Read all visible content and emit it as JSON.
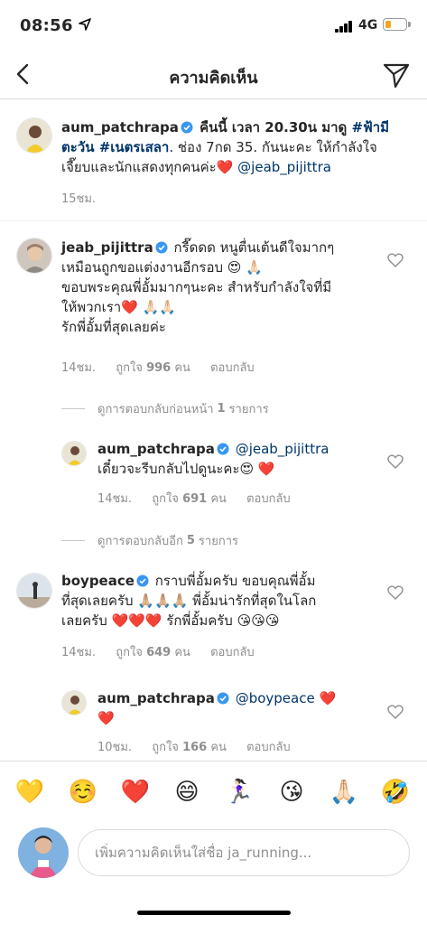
{
  "status_bar": {
    "time": "08:56",
    "network": "4G"
  },
  "nav": {
    "title": "ความคิดเห็น"
  },
  "caption": {
    "username": "aum_patchrapa",
    "text_a": " คืนนี้ เวลา 20.30น มาดู ",
    "tag1": "#ฟ้ามี",
    "tag2": "ตะวัน #เนตรเสลา",
    "text_b": ". ช่อง 7กด 35. กันนะคะ ให้กำลังใจ",
    "text_c": "เจี๊ยบและนักแสดงทุกคนค่ะ❤️ ",
    "mention": "@jeab_pijittra",
    "time": "15ชม."
  },
  "comments": [
    {
      "username": "jeab_pijittra",
      "line1": " กรี๊ดดด หนูตื่นเต้นดีใจมากๆ",
      "line2": "เหมือนถูกขอแต่งงานอีกรอบ 😍 🙏🏻",
      "line3": "ขอบพระคุณพี่อั้มมากๆนะคะ สำหรับกำลังใจที่มี",
      "line4": "ให้พวกเรา❤️ 🙏🏻🙏🏻",
      "line5": "รักพี่อั้มที่สุดเลยค่ะ",
      "time": "14ชม.",
      "likes_prefix": "ถูกใจ",
      "likes": "996",
      "likes_suffix": "คน",
      "reply": "ตอบกลับ"
    }
  ],
  "view_previous": {
    "prefix": "ดูการตอบกลับก่อนหน้า",
    "count": "1",
    "suffix": "รายการ"
  },
  "reply1": {
    "username": "aum_patchrapa",
    "mention": " @jeab_pijittra",
    "line2": "เดี๋ยวจะรีบกลับไปดูนะคะ😍 ❤️",
    "time": "14ชม.",
    "likes_prefix": "ถูกใจ",
    "likes": "691",
    "likes_suffix": "คน",
    "reply": "ตอบกลับ"
  },
  "view_more": {
    "prefix": "ดูการตอบกลับอีก",
    "count": "5",
    "suffix": "รายการ"
  },
  "comment2": {
    "username": "boypeace",
    "line1": " กราบพี่อั้มครับ ขอบคุณพี่อั้ม",
    "line2": "ที่สุดเลยครับ 🙏🏼🙏🏼🙏🏼 พี่อั้มน่ารักที่สุดในโลก",
    "line3": "เลยครับ ❤️❤️❤️ รักพี่อั้มครับ 😘😘😘",
    "time": "14ชม.",
    "likes_prefix": "ถูกใจ",
    "likes": "649",
    "likes_suffix": "คน",
    "reply": "ตอบกลับ"
  },
  "reply2": {
    "username": "aum_patchrapa",
    "mention": " @boypeace",
    "heart": " ❤️",
    "line2": "❤️",
    "time": "10ชม.",
    "likes_prefix": "ถูกใจ",
    "likes": "166",
    "likes_suffix": "คน",
    "reply": "ตอบกลับ"
  },
  "emoji_bar": [
    "💛",
    "☺️",
    "❤️",
    "😄",
    "🏃🏻‍♀️",
    "😘",
    "🙏🏻",
    "🤣"
  ],
  "input": {
    "placeholder": "เพิ่มความคิดเห็นใส่ชื่อ ja_running..."
  },
  "colors": {
    "link": "#003569",
    "verified": "#3897f0",
    "muted": "#8e8e8e"
  }
}
